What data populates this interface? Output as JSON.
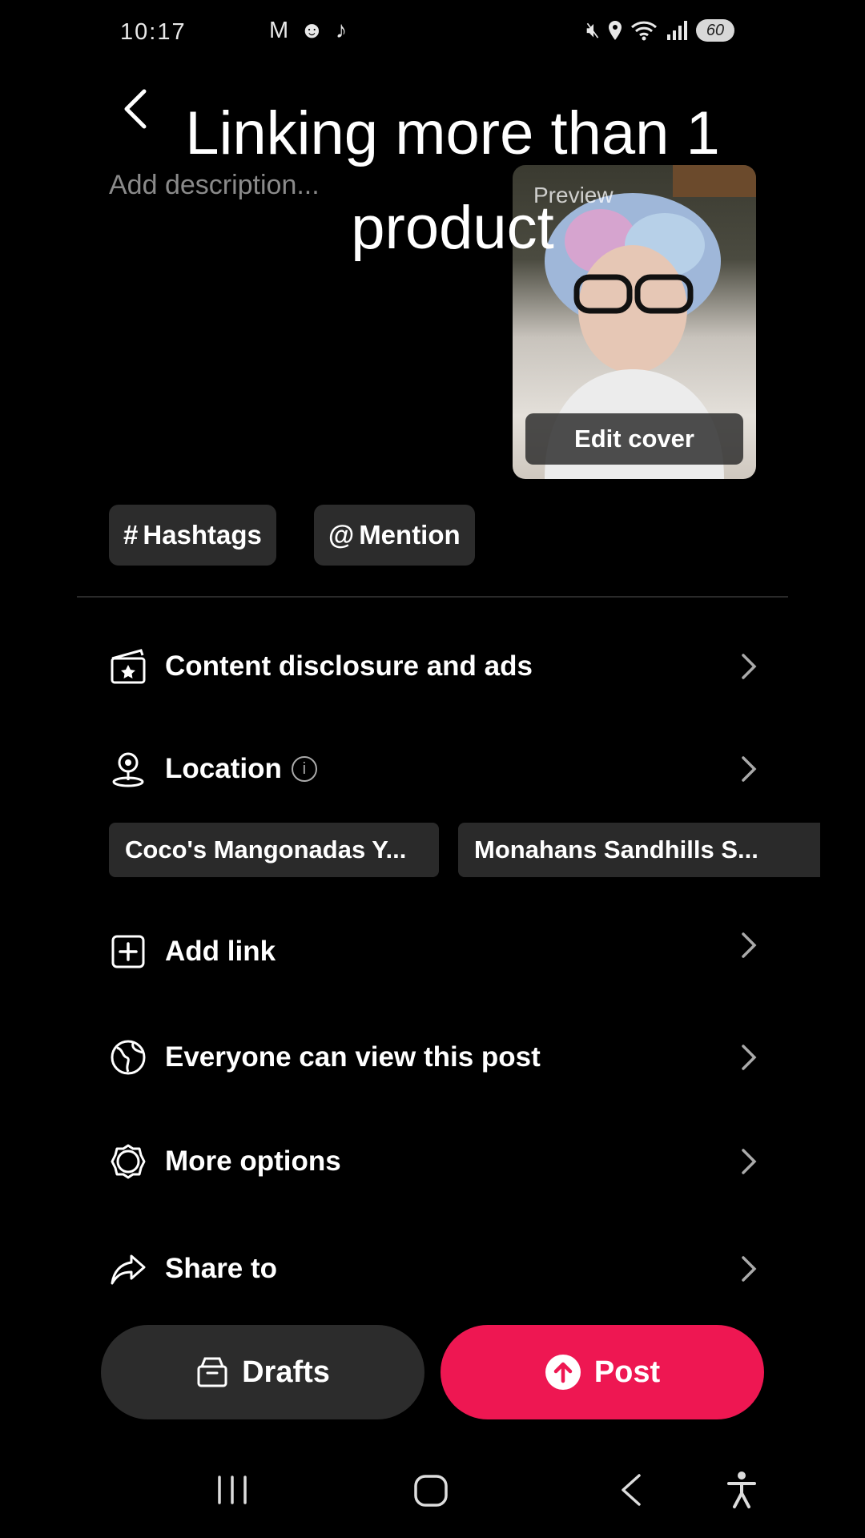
{
  "status_bar": {
    "time": "10:17",
    "left_icons": [
      "gmail-icon",
      "discord-icon",
      "tiktok-icon"
    ],
    "right_icons": [
      "mute-icon",
      "location-icon",
      "wifi-icon",
      "signal-icon"
    ],
    "battery": "60"
  },
  "header": {
    "overlay_title": "Linking more than 1 product",
    "description_placeholder": "Add description..."
  },
  "cover": {
    "preview_label": "Preview",
    "edit_cover_label": "Edit cover"
  },
  "chips": {
    "hashtags": "Hashtags",
    "hashtags_symbol": "#",
    "mention": "Mention",
    "mention_symbol": "@"
  },
  "rows": {
    "content_disclosure": "Content disclosure and ads",
    "location": "Location",
    "add_link": "Add link",
    "visibility": "Everyone can view this post",
    "more_options": "More options",
    "share_to": "Share to"
  },
  "location_suggestions": [
    "Coco's Mangonadas Y...",
    "Monahans Sandhills S..."
  ],
  "buttons": {
    "drafts": "Drafts",
    "post": "Post"
  },
  "colors": {
    "post_button": "#ee1752",
    "background": "#000000",
    "chip": "#2c2c2c"
  }
}
